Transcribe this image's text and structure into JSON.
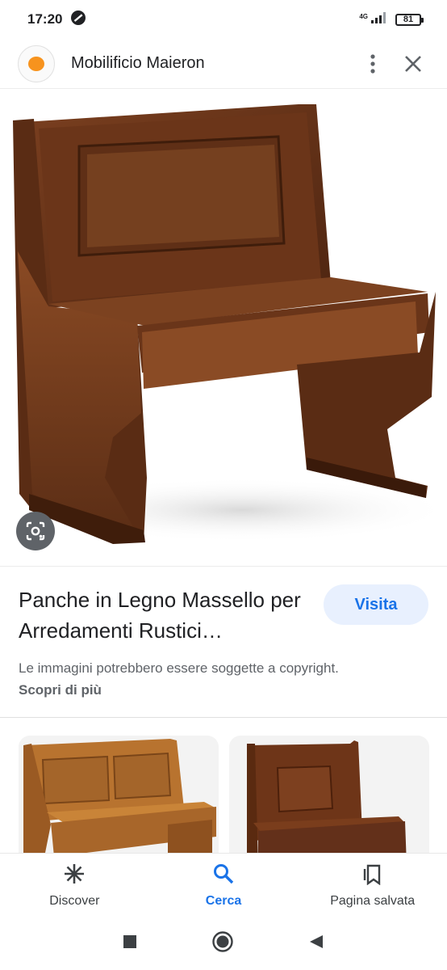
{
  "status_bar": {
    "time": "17:20",
    "network": "4G",
    "battery": "81"
  },
  "header": {
    "site_name": "Mobilificio Maieron",
    "menu_icon": "more-vert-icon",
    "close_icon": "close-icon"
  },
  "result": {
    "title": "Panche in Legno Massello per Arredamenti Rustici…",
    "visit_label": "Visita",
    "copyright_text": "Le immagini potrebbero essere soggette a copyright.",
    "learn_more": "Scopri di più"
  },
  "bottom_nav": {
    "items": [
      {
        "label": "Discover",
        "icon": "asterisk-icon"
      },
      {
        "label": "Cerca",
        "icon": "search-icon"
      },
      {
        "label": "Pagina salvata",
        "icon": "bookmarks-icon"
      }
    ]
  },
  "colors": {
    "accent": "#1a73e8",
    "wood_dark": "#5a2e17",
    "wood_light": "#b8732f"
  }
}
